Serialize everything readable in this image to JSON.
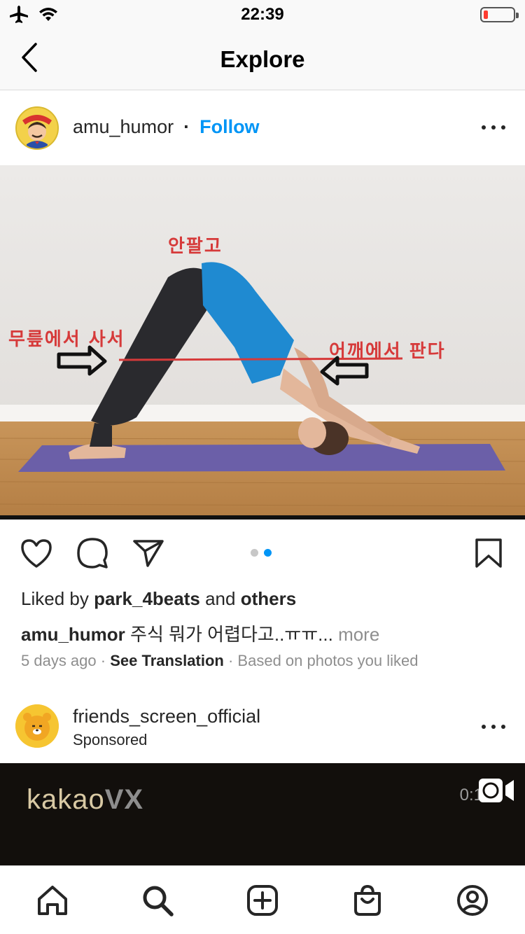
{
  "status_bar": {
    "time": "22:39",
    "icons": [
      "airplane-icon",
      "wifi-icon",
      "battery-low-icon"
    ],
    "battery_color": "#ff3b30"
  },
  "header": {
    "title": "Explore",
    "back_icon": "chevron-left-icon"
  },
  "post": {
    "username": "amu_humor",
    "separator": "·",
    "follow_label": "Follow",
    "follow_color": "#0095f6",
    "more_icon": "ellipsis-icon",
    "image": {
      "labels": {
        "top": "안팔고",
        "left": "무릎에서 사서",
        "right": "어깨에서 판다"
      }
    },
    "actions": {
      "like_icon": "heart-icon",
      "comment_icon": "comment-icon",
      "share_icon": "paper-plane-icon",
      "save_icon": "bookmark-icon",
      "carousel_total": 2,
      "carousel_active": 2
    },
    "liked_by": {
      "prefix": "Liked by",
      "user": "park_4beats",
      "middle": "and",
      "others": "others"
    },
    "caption": {
      "username": "amu_humor",
      "text": "주식 뭐가 어렵다고..ㅠㅠ...",
      "more": "more"
    },
    "meta": {
      "time_ago": "5 days ago",
      "dot": "·",
      "see_translation": "See Translation",
      "reason": "Based on photos you liked"
    }
  },
  "post2": {
    "username": "friends_screen_official",
    "sponsored": "Sponsored",
    "more_icon": "ellipsis-icon",
    "video": {
      "logo_part1": "kakao",
      "logo_part2": "VX",
      "time_text": "0:1"
    }
  },
  "tab_bar": {
    "items": [
      {
        "name": "home",
        "icon": "home-icon"
      },
      {
        "name": "search",
        "icon": "search-icon"
      },
      {
        "name": "create",
        "icon": "plus-square-icon"
      },
      {
        "name": "shop",
        "icon": "shopping-bag-icon"
      },
      {
        "name": "profile",
        "icon": "profile-icon"
      }
    ]
  }
}
